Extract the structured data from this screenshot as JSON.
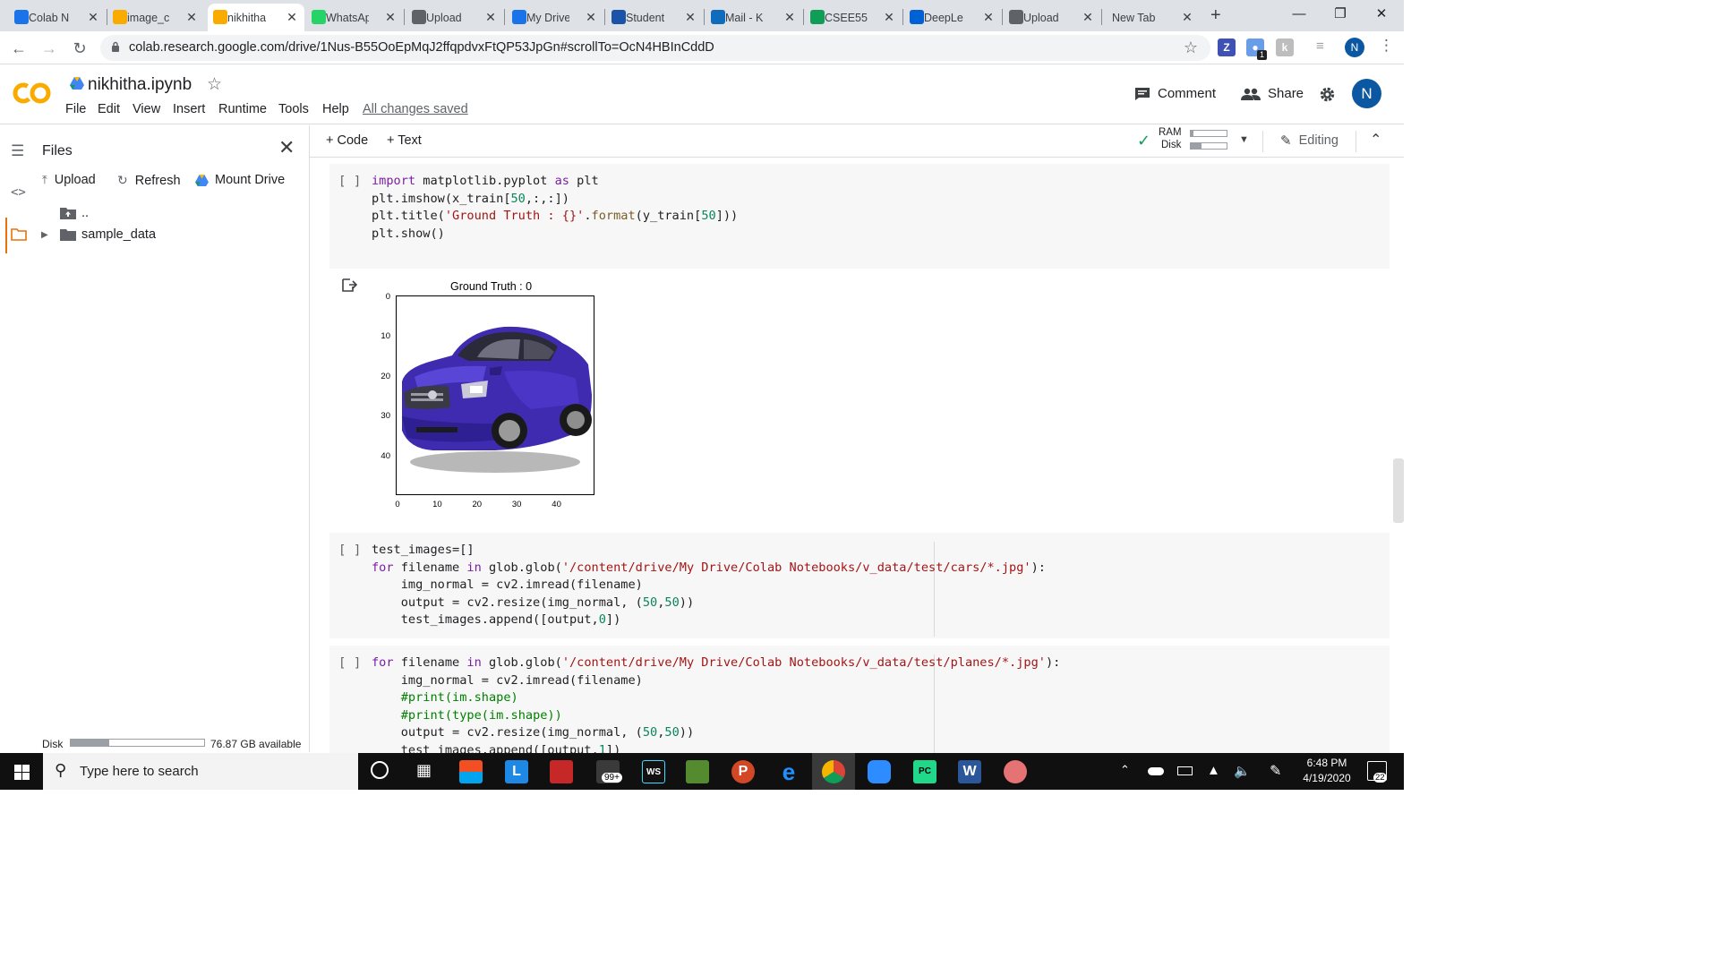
{
  "browser": {
    "tabs": [
      {
        "title": "Colab N",
        "icon": "drive-icon",
        "color": "#1a73e8"
      },
      {
        "title": "image_c",
        "icon": "colab-icon",
        "color": "#f9ab00"
      },
      {
        "title": "nikhitha",
        "icon": "colab-icon",
        "color": "#f9ab00",
        "active": true
      },
      {
        "title": "WhatsAp",
        "icon": "whatsapp-icon",
        "color": "#25d366"
      },
      {
        "title": "Upload",
        "icon": "globe-icon",
        "color": "#5f6368"
      },
      {
        "title": "My Drive",
        "icon": "drive-icon",
        "color": "#1a73e8"
      },
      {
        "title": "Student",
        "icon": "student-icon",
        "color": "#1a53a8"
      },
      {
        "title": "Mail - K",
        "icon": "outlook-icon",
        "color": "#0f6cbd"
      },
      {
        "title": "CSEE55",
        "icon": "sheets-icon",
        "color": "#0f9d58"
      },
      {
        "title": "DeepLe",
        "icon": "box-icon",
        "color": "#0061d5"
      },
      {
        "title": "Upload",
        "icon": "globe-icon",
        "color": "#5f6368"
      },
      {
        "title": "New Tab",
        "icon": "",
        "color": ""
      }
    ],
    "url": "colab.research.google.com/drive/1Nus-B55OoEpMqJ2ffqpdvxFtQP53JpGn#scrollTo=OcN4HBInCddD",
    "profile_initial": "N",
    "ext_badge": "1"
  },
  "colab": {
    "notebook_title": "nikhitha.ipynb",
    "menu": [
      "File",
      "Edit",
      "View",
      "Insert",
      "Runtime",
      "Tools",
      "Help"
    ],
    "saved_status": "All changes saved",
    "comment_label": "Comment",
    "share_label": "Share",
    "avatar_initial": "N",
    "add_code": "+ Code",
    "add_text": "+ Text",
    "ram_label": "RAM",
    "disk_label": "Disk",
    "editing_label": "Editing"
  },
  "sidebar": {
    "title": "Files",
    "upload": "Upload",
    "refresh": "Refresh",
    "mount": "Mount Drive",
    "parent_dir": "..",
    "folder": "sample_data",
    "disk_label": "Disk",
    "disk_available": "76.87 GB available",
    "disk_used_fraction": 0.29
  },
  "cells": {
    "cell1_gutter": "[ ]",
    "cell2_gutter": "[ ]",
    "cell3_gutter": "[ ]",
    "plot_title": "Ground Truth : 0",
    "x_ticks": [
      "0",
      "10",
      "20",
      "30",
      "40"
    ],
    "y_ticks": [
      "0",
      "10",
      "20",
      "30",
      "40"
    ]
  },
  "taskbar": {
    "search_placeholder": "Type here to search",
    "time": "6:48 PM",
    "date": "4/19/2020",
    "notif_count": "22",
    "mail_badge": "99+"
  }
}
